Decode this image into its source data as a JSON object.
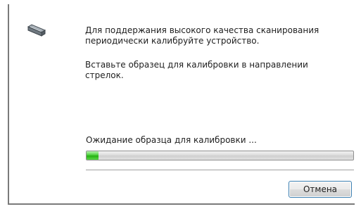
{
  "dialog": {
    "message_1": "Для поддержания высокого качества сканирования периодически калибруйте устройство.",
    "message_2": "Вставьте образец для калибровки в направлении стрелок.",
    "status_text": "Ожидание образца для калибровки ...",
    "progress_fraction": 0.045,
    "cancel_label": "Отмена"
  },
  "icons": {
    "device": "scanner-icon"
  },
  "colors": {
    "progress_green": "#25b112",
    "button_border": "#3c7fb1"
  }
}
